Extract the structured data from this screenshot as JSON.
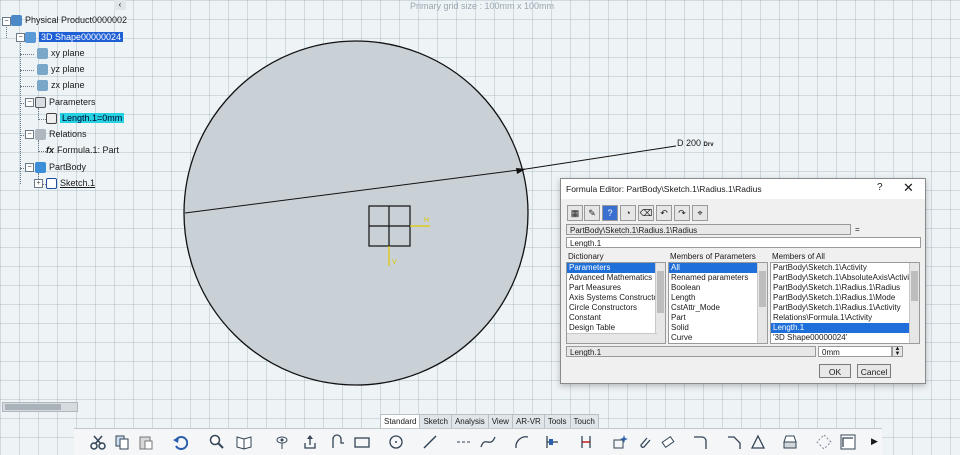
{
  "viewport": {
    "grid_label": "Primary grid size : 100mm x 100mm"
  },
  "tree": {
    "root": "Physical Product0000002",
    "shape": "3D Shape00000024",
    "planes": [
      "xy plane",
      "yz plane",
      "zx plane"
    ],
    "parameters": "Parameters",
    "param_item": "Length.1=0mm",
    "relations": "Relations",
    "formula": "Formula.1: Part",
    "partbody": "PartBody",
    "sketch": "Sketch.1"
  },
  "dimension": {
    "label": "D 200",
    "suffix": "Drv"
  },
  "dialog": {
    "title": "Formula Editor: PartBody\\Sketch.1\\Radius.1\\Radius",
    "help": "?",
    "close": "✕",
    "target_path": "PartBody\\Sketch.1\\Radius.1\\Radius",
    "equals": "=",
    "formula": "Length.1",
    "dictionary_label": "Dictionary",
    "members_params_label": "Members of Parameters",
    "members_all_label": "Members of All",
    "dictionary": [
      "Parameters",
      "Advanced Mathematics Fu",
      "Part Measures",
      "Axis Systems Constructors",
      "Circle Constructors",
      "Constant",
      "Design Table"
    ],
    "members_params": [
      "All",
      "Renamed parameters",
      "Boolean",
      "Length",
      "CstAttr_Mode",
      "Part",
      "Solid",
      "Curve"
    ],
    "members_all": [
      "PartBody\\Sketch.1\\Activity",
      "PartBody\\Sketch.1\\AbsoluteAxis\\Activity",
      "PartBody\\Sketch.1\\Radius.1\\Radius",
      "PartBody\\Sketch.1\\Radius.1\\Mode",
      "PartBody\\Sketch.1\\Radius.1\\Activity",
      "Relations\\Formula.1\\Activity",
      "Length.1",
      "'3D Shape00000024'"
    ],
    "selected_name": "Length.1",
    "value": "0mm",
    "ok": "OK",
    "cancel": "Cancel"
  },
  "tabs": [
    "Standard",
    "Sketch",
    "Analysis",
    "View",
    "AR-VR",
    "Tools",
    "Touch"
  ],
  "colors": {
    "selection": "#1e5fd6",
    "param_highlight": "#26d1e0",
    "disk": "#c9d0d6"
  }
}
